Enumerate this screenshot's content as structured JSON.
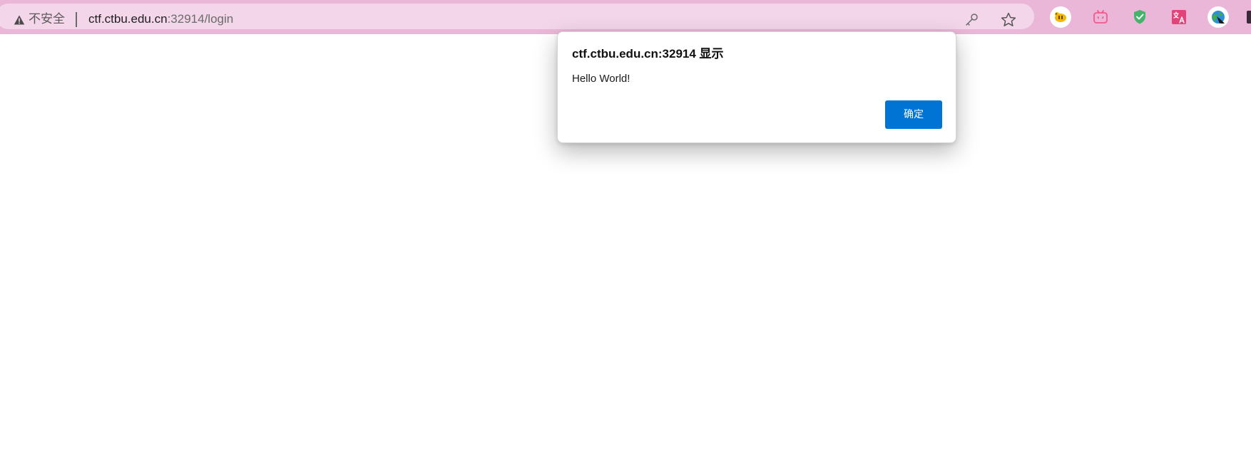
{
  "browser": {
    "security_label": "不安全",
    "url_host": "ctf.ctbu.edu.cn",
    "url_rest": ":32914/login",
    "icons": {
      "warning": "warning-triangle-icon",
      "key": "key-icon",
      "bookmark": "star-icon"
    },
    "extensions": [
      "tiger-extension-icon",
      "bilibili-extension-icon",
      "shield-extension-icon",
      "translate-extension-icon",
      "globe-extension-icon"
    ],
    "colors": {
      "toolbar": "#ebb7d8",
      "omnibox": "#f4d6ea"
    }
  },
  "alert": {
    "title": "ctf.ctbu.edu.cn:32914 显示",
    "message": "Hello World!",
    "ok_label": "确定",
    "button_color": "#0074d4"
  }
}
